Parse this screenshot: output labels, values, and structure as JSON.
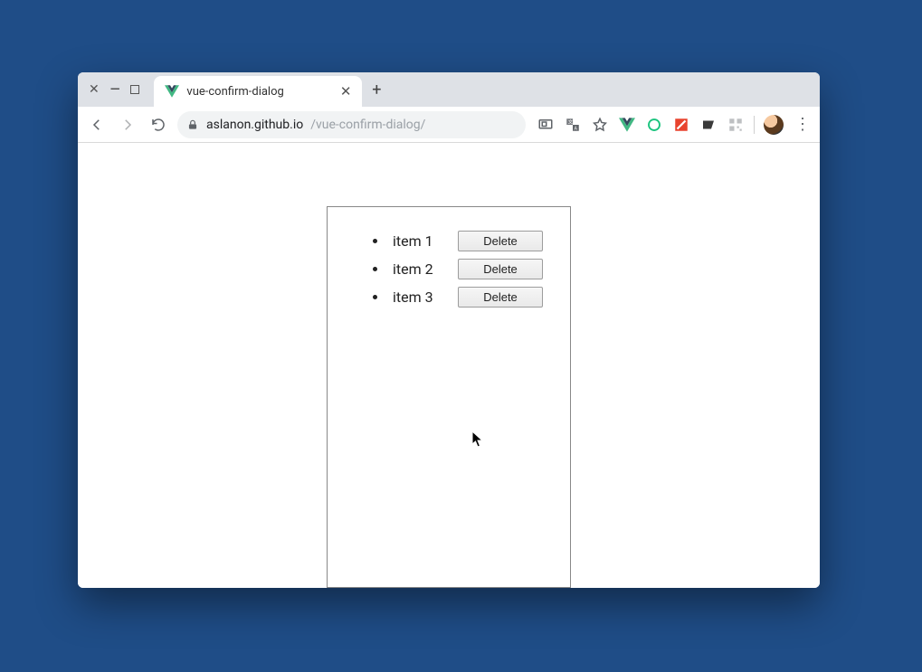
{
  "window": {
    "tab_title": "vue-confirm-dialog",
    "url_host": "aslanon.github.io",
    "url_path": "/vue-confirm-dialog/"
  },
  "list": {
    "items": [
      {
        "label": "item 1",
        "button": "Delete"
      },
      {
        "label": "item 2",
        "button": "Delete"
      },
      {
        "label": "item 3",
        "button": "Delete"
      }
    ]
  }
}
